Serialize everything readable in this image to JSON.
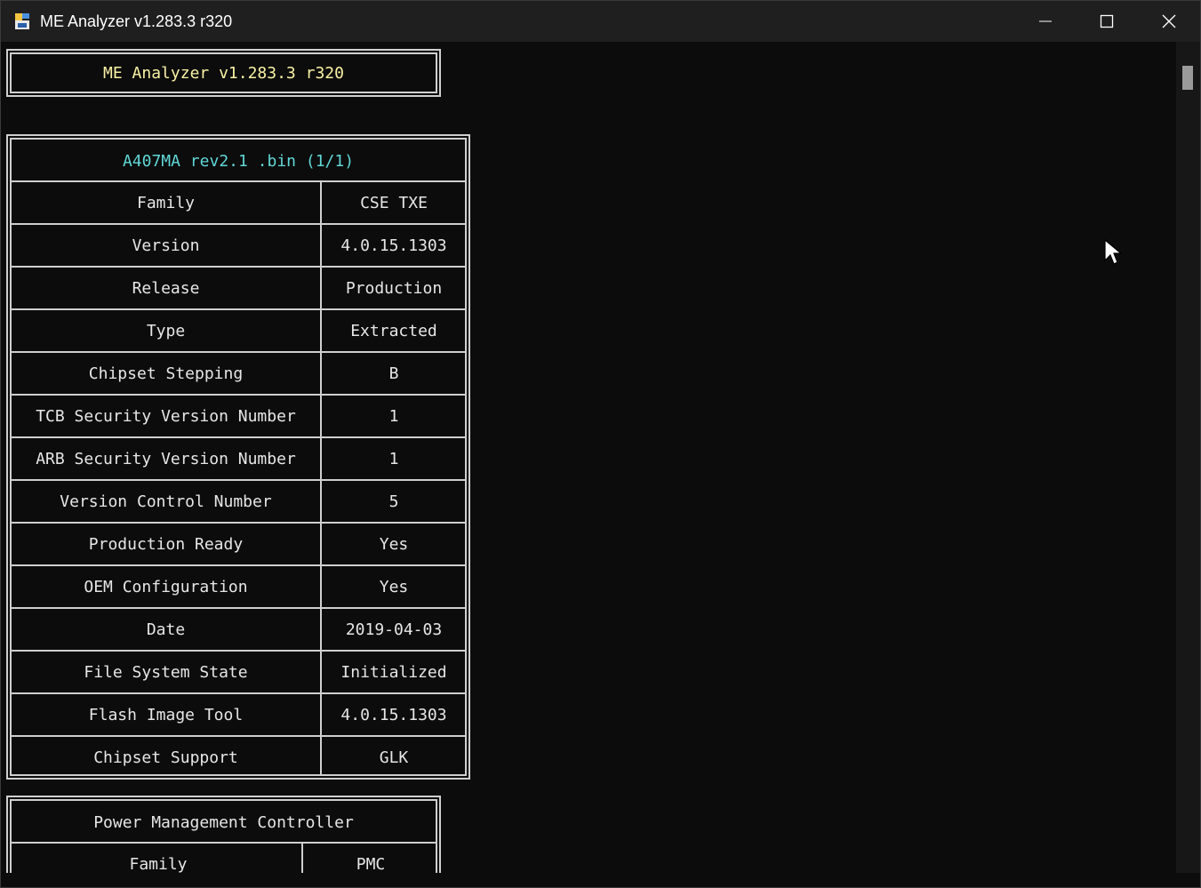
{
  "window": {
    "title": "ME Analyzer v1.283.3 r320"
  },
  "header_box": {
    "text": "ME Analyzer v1.283.3 r320"
  },
  "main_table": {
    "title": "A407MA rev2.1 .bin (1/1)",
    "rows": [
      {
        "label": "Family",
        "value": "CSE TXE"
      },
      {
        "label": "Version",
        "value": "4.0.15.1303"
      },
      {
        "label": "Release",
        "value": "Production"
      },
      {
        "label": "Type",
        "value": "Extracted"
      },
      {
        "label": "Chipset Stepping",
        "value": "B"
      },
      {
        "label": "TCB Security Version Number",
        "value": "1"
      },
      {
        "label": "ARB Security Version Number",
        "value": "1"
      },
      {
        "label": "Version Control Number",
        "value": "5"
      },
      {
        "label": "Production Ready",
        "value": "Yes"
      },
      {
        "label": "OEM Configuration",
        "value": "Yes"
      },
      {
        "label": "Date",
        "value": "2019-04-03"
      },
      {
        "label": "File System State",
        "value": "Initialized"
      },
      {
        "label": "Flash Image Tool",
        "value": "4.0.15.1303"
      },
      {
        "label": "Chipset Support",
        "value": "GLK"
      }
    ]
  },
  "pmc_table": {
    "title": "Power Management Controller",
    "rows": [
      {
        "label": "Family",
        "value": "PMC"
      }
    ]
  },
  "icons": {
    "app": "app-icon",
    "minimize": "minimize-icon",
    "maximize": "maximize-icon",
    "close": "close-icon",
    "cursor": "mouse-pointer-icon"
  },
  "colors": {
    "background": "#0c0c0c",
    "titlebar": "#1f1f1f",
    "header_text": "#f9f1a5",
    "title_text": "#61d6d6",
    "table_text": "#e6e6e6",
    "border": "#cfcfcf"
  }
}
